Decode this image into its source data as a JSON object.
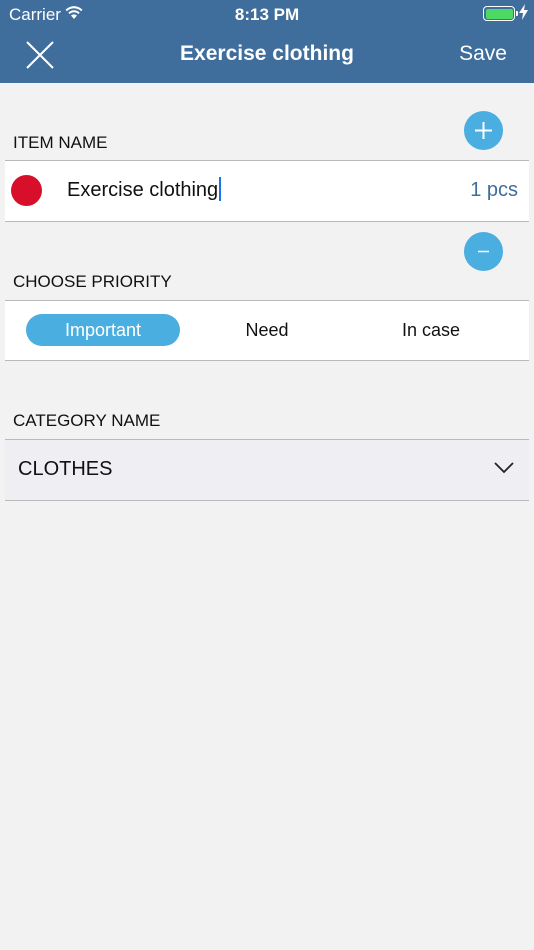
{
  "status_bar": {
    "carrier": "Carrier",
    "time": "8:13 PM",
    "battery_color": "#4cd964"
  },
  "nav": {
    "title": "Exercise clothing",
    "save_label": "Save",
    "close_icon": "close-icon"
  },
  "item_section": {
    "label": "ITEM NAME",
    "name_value": "Exercise clothing",
    "quantity": "1 pcs",
    "priority_dot_color": "#d80f2a",
    "plus_icon": "plus-icon",
    "minus_icon": "minus-icon"
  },
  "priority_section": {
    "label": "CHOOSE PRIORITY",
    "options": [
      "Important",
      "Need",
      "In case"
    ],
    "selected": "Important"
  },
  "category_section": {
    "label": "CATEGORY NAME",
    "selected_value": "CLOTHES"
  },
  "colors": {
    "header": "#3f6d9c",
    "accent": "#4aaee0"
  }
}
